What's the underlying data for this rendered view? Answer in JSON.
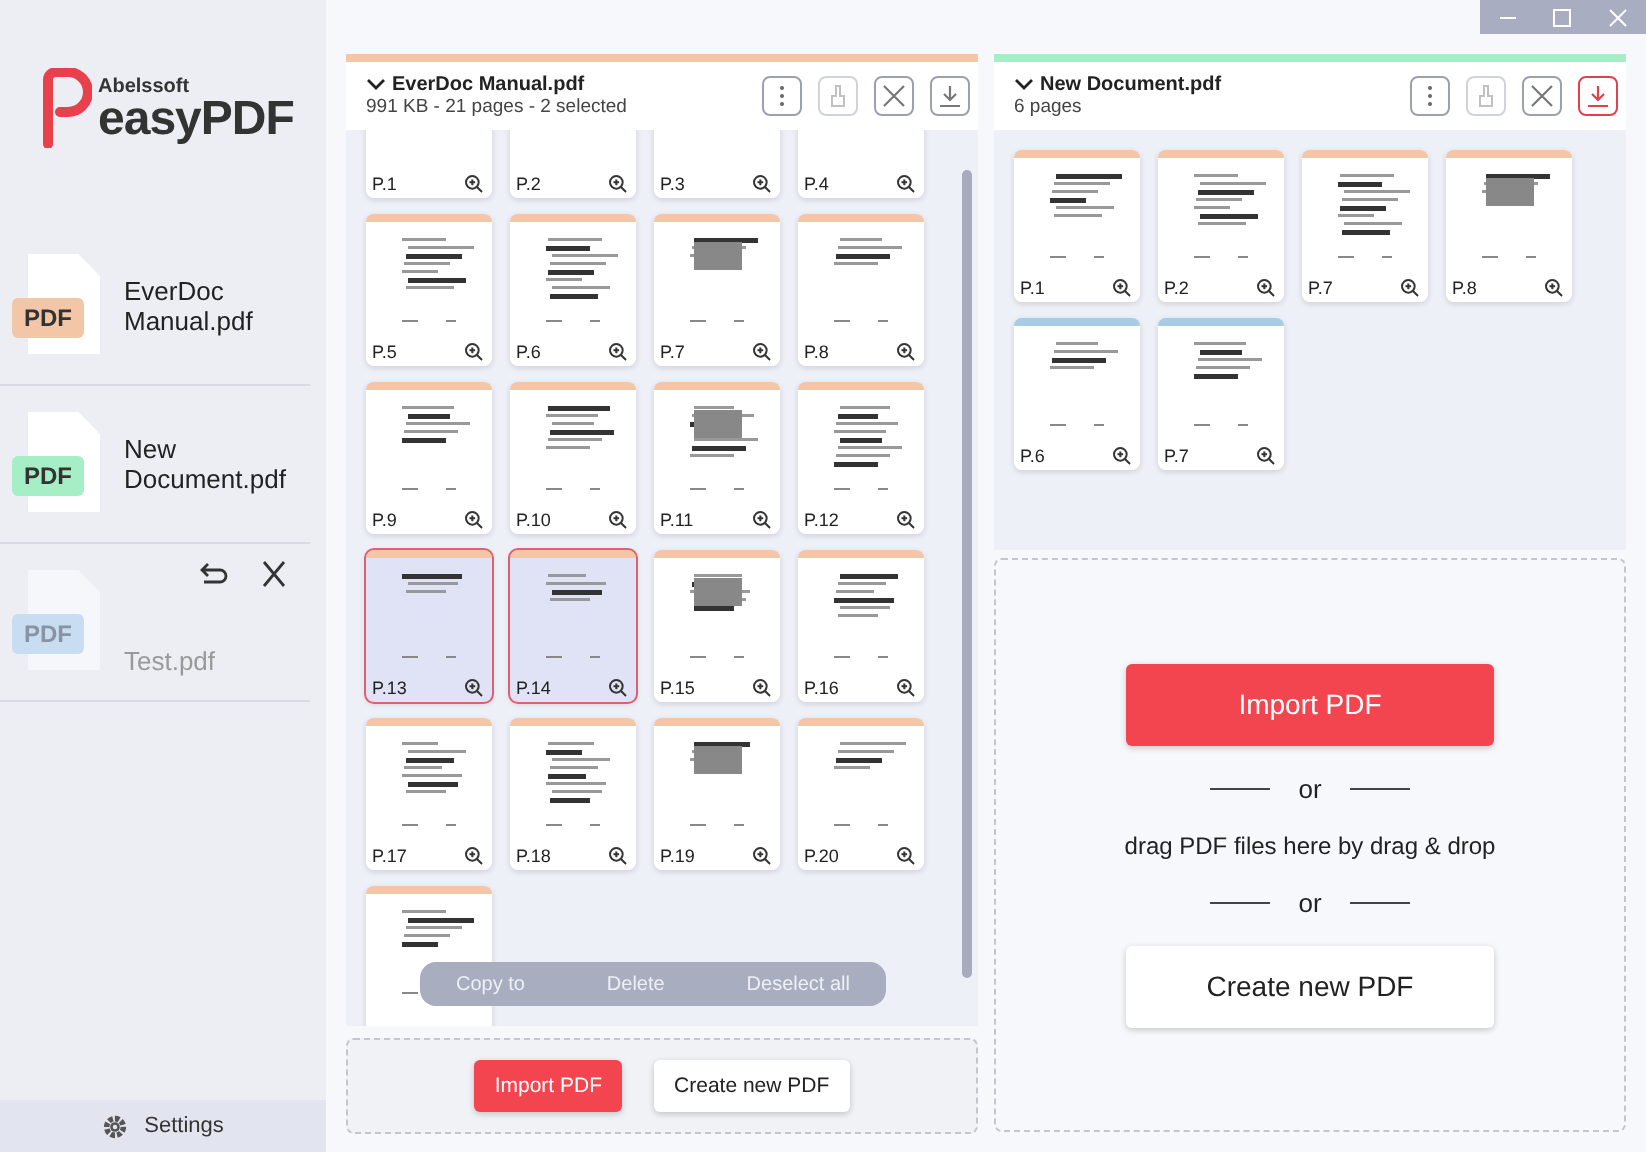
{
  "logo": {
    "brand": "Abelssoft",
    "name": "easyPDF"
  },
  "sidebar": {
    "files": [
      {
        "name": "EverDoc Manual.pdf",
        "badge": "PDF",
        "color": "#f2c6a6",
        "removed": false
      },
      {
        "name": "New Document.pdf",
        "badge": "PDF",
        "color": "#a6eec6",
        "removed": false
      },
      {
        "name": "Test.pdf",
        "badge": "PDF",
        "color": "#c8dcf2",
        "removed": true
      }
    ],
    "settings": "Settings"
  },
  "documents": [
    {
      "title": "EverDoc Manual.pdf",
      "info": "991 KB - 21 pages - 2 selected",
      "color": "#f2c6a6",
      "save_highlighted": false,
      "pages": [
        {
          "label": "P.1",
          "selected": false
        },
        {
          "label": "P.2",
          "selected": false
        },
        {
          "label": "P.3",
          "selected": false
        },
        {
          "label": "P.4",
          "selected": false
        },
        {
          "label": "P.5",
          "color": "#f2c6a6",
          "selected": false
        },
        {
          "label": "P.6",
          "color": "#f2c6a6",
          "selected": false
        },
        {
          "label": "P.7",
          "color": "#f2c6a6",
          "selected": false
        },
        {
          "label": "P.8",
          "color": "#f2c6a6",
          "selected": false
        },
        {
          "label": "P.9",
          "color": "#f2c6a6",
          "selected": false
        },
        {
          "label": "P.10",
          "color": "#f2c6a6",
          "selected": false
        },
        {
          "label": "P.11",
          "color": "#f2c6a6",
          "selected": false
        },
        {
          "label": "P.12",
          "color": "#f2c6a6",
          "selected": false
        },
        {
          "label": "P.13",
          "color": "#f2c6a6",
          "selected": true
        },
        {
          "label": "P.14",
          "color": "#f2c6a6",
          "selected": true
        },
        {
          "label": "P.15",
          "color": "#f2c6a6",
          "selected": false
        },
        {
          "label": "P.16",
          "color": "#f2c6a6",
          "selected": false
        },
        {
          "label": "P.17",
          "color": "#f2c6a6",
          "selected": false
        },
        {
          "label": "P.18",
          "color": "#f2c6a6",
          "selected": false
        },
        {
          "label": "P.19",
          "color": "#f2c6a6",
          "selected": false
        },
        {
          "label": "P.20",
          "color": "#f2c6a6",
          "selected": false
        },
        {
          "color": "#f2c6a6",
          "selected": false
        }
      ],
      "actions": [
        "Copy to",
        "Delete",
        "Deselect all"
      ],
      "drop": {
        "import": "Import PDF",
        "create": "Create new PDF"
      }
    },
    {
      "title": "New Document.pdf",
      "info": "6 pages",
      "color": "#a6eec6",
      "save_highlighted": true,
      "pages": [
        {
          "label": "P.1",
          "color": "#f2c6a6",
          "selected": false
        },
        {
          "label": "P.2",
          "color": "#f2c6a6",
          "selected": false
        },
        {
          "label": "P.7",
          "color": "#f2c6a6",
          "selected": false
        },
        {
          "label": "P.8",
          "color": "#f2c6a6",
          "selected": false
        },
        {
          "label": "P.6",
          "color": "#a8cce6",
          "selected": false
        },
        {
          "label": "P.7",
          "color": "#a8cce6",
          "selected": false
        }
      ],
      "drop": {
        "import": "Import PDF",
        "or_1": "or",
        "hint": "drag PDF files here by drag & drop",
        "or_2": "or",
        "create": "Create new PDF"
      }
    }
  ]
}
